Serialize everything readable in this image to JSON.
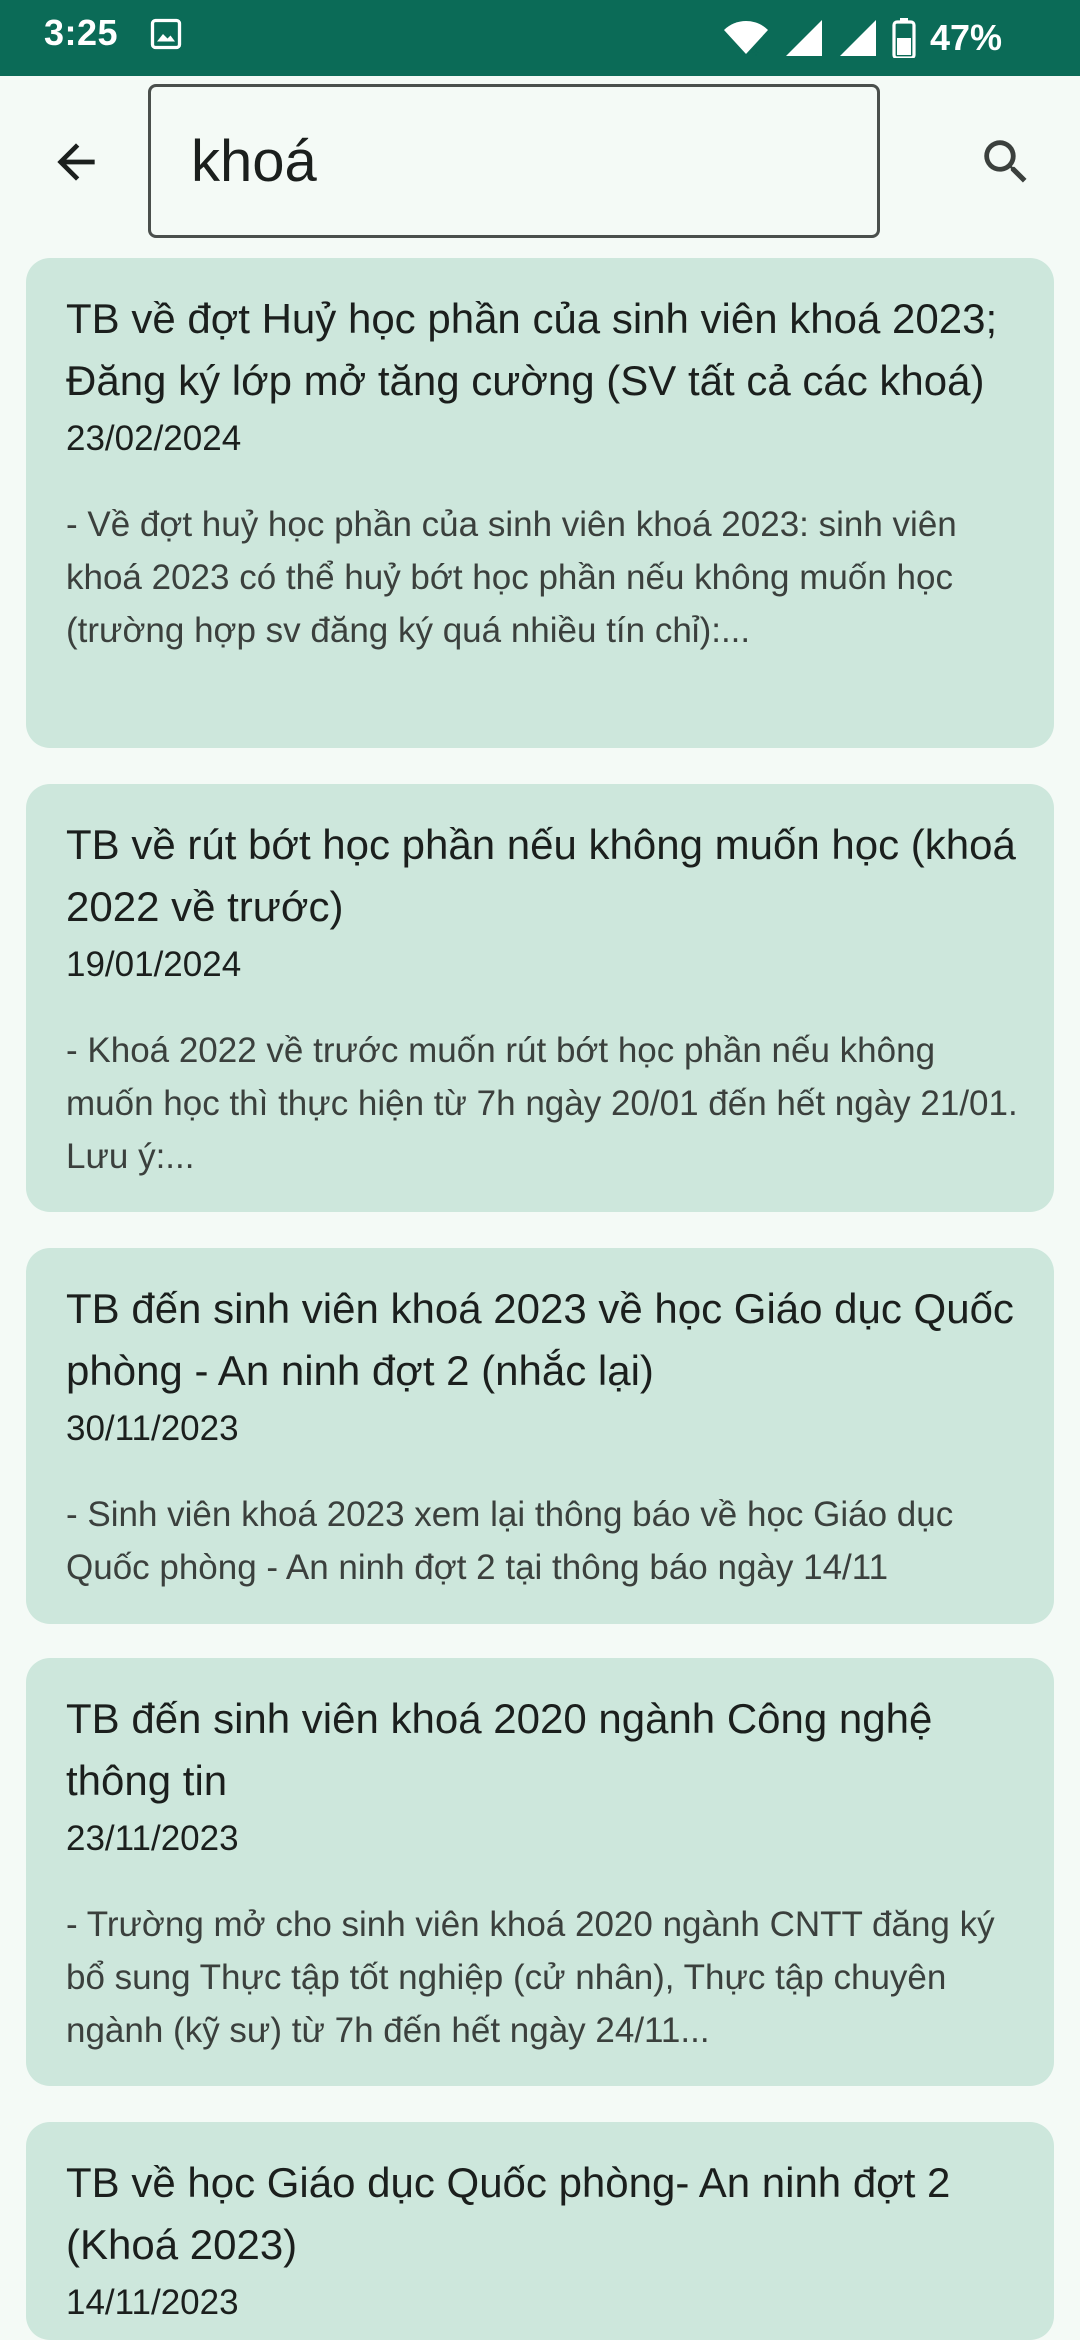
{
  "status_bar": {
    "time": "3:25",
    "battery": "47%",
    "icons": [
      "gallery-icon",
      "wifi-icon",
      "signal-icon",
      "signal-icon",
      "battery-icon"
    ]
  },
  "search": {
    "value": "khoá",
    "back_icon": "arrow-back-icon",
    "search_icon": "search-icon"
  },
  "results": [
    {
      "title": "TB về đợt Huỷ học phần của sinh viên khoá 2023; Đăng ký lớp mở tăng cường (SV tất cả các khoá)",
      "date": "23/02/2024",
      "excerpt": "- Về đợt huỷ học phần của sinh viên khoá 2023: sinh viên khoá 2023 có thể huỷ bớt học phần nếu không muốn học (trường hợp sv đăng ký quá nhiều tín chỉ):..."
    },
    {
      "title": "TB về rút bớt học phần nếu không muốn học (khoá 2022 về trước)",
      "date": "19/01/2024",
      "excerpt": "- Khoá 2022 về trước muốn rút bớt học phần nếu không muốn học thì thực hiện từ 7h ngày 20/01 đến hết ngày 21/01. Lưu ý:..."
    },
    {
      "title": "TB đến sinh viên khoá 2023 về học Giáo dục Quốc phòng - An ninh đợt 2 (nhắc lại)",
      "date": "30/11/2023",
      "excerpt": "- Sinh viên khoá 2023 xem lại thông báo về học Giáo dục Quốc phòng - An ninh đợt 2 tại thông báo ngày 14/11"
    },
    {
      "title": "TB đến sinh viên khoá 2020 ngành Công nghệ thông tin",
      "date": "23/11/2023",
      "excerpt": "- Trường mở cho sinh viên khoá 2020 ngành CNTT đăng ký bổ sung Thực tập tốt nghiệp (cử nhân), Thực tập chuyên ngành (kỹ sư) từ 7h đến hết ngày 24/11..."
    },
    {
      "title": "TB về học Giáo dục Quốc phòng- An ninh đợt 2 (Khoá 2023)",
      "date": "14/11/2023",
      "excerpt": ""
    }
  ],
  "colors": {
    "status_bar": "#0b6b57",
    "background": "#f4faf6",
    "card": "#cde7dc"
  }
}
